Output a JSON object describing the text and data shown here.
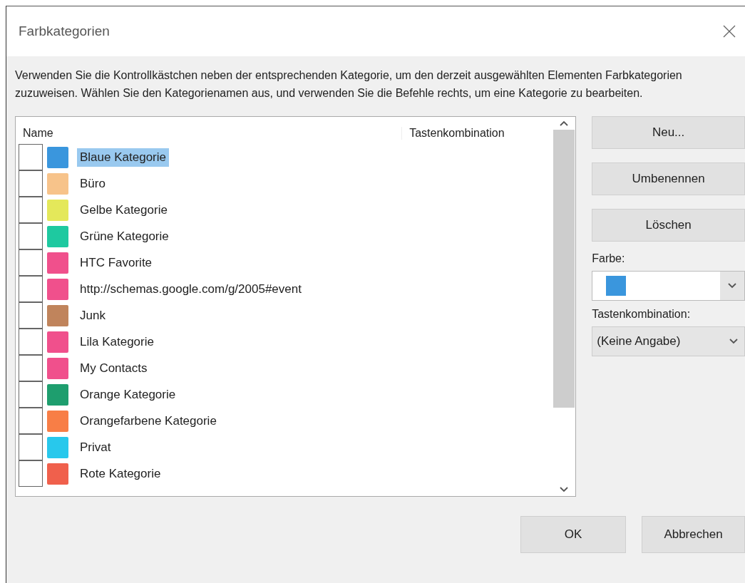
{
  "window": {
    "title": "Farbkategorien"
  },
  "description": "Verwenden Sie die Kontrollkästchen neben der entsprechenden Kategorie, um den derzeit ausgewählten Elementen Farbkategorien zuzuweisen. Wählen Sie den Kategorienamen aus, und verwenden Sie die Befehle rechts, um eine Kategorie zu bearbeiten.",
  "list": {
    "columns": [
      "Name",
      "Tastenkombination"
    ],
    "rows": [
      {
        "name": "Blaue Kategorie",
        "color": "#3a96dd",
        "checked": false,
        "selected": true
      },
      {
        "name": "Büro",
        "color": "#f7c38a",
        "checked": false,
        "selected": false
      },
      {
        "name": "Gelbe Kategorie",
        "color": "#e4e85a",
        "checked": false,
        "selected": false
      },
      {
        "name": "Grüne Kategorie",
        "color": "#1ec9a0",
        "checked": false,
        "selected": false
      },
      {
        "name": "HTC Favorite",
        "color": "#f0508c",
        "checked": false,
        "selected": false
      },
      {
        "name": "http://schemas.google.com/g/2005#event",
        "color": "#f0508c",
        "checked": false,
        "selected": false
      },
      {
        "name": "Junk",
        "color": "#c0845c",
        "checked": false,
        "selected": false
      },
      {
        "name": "Lila Kategorie",
        "color": "#f0508c",
        "checked": false,
        "selected": false
      },
      {
        "name": "My Contacts",
        "color": "#f0508c",
        "checked": false,
        "selected": false
      },
      {
        "name": "Orange Kategorie",
        "color": "#1e9e6e",
        "checked": false,
        "selected": false
      },
      {
        "name": "Orangefarbene Kategorie",
        "color": "#f87e46",
        "checked": false,
        "selected": false
      },
      {
        "name": "Privat",
        "color": "#28c8ec",
        "checked": false,
        "selected": false
      },
      {
        "name": "Rote Kategorie",
        "color": "#f0604c",
        "checked": false,
        "selected": false
      }
    ]
  },
  "side_buttons": [
    "Neu...",
    "Umbenennen",
    "Löschen"
  ],
  "color_field": {
    "label": "Farbe:",
    "color": "#3a96dd"
  },
  "shortcut_field": {
    "label": "Tastenkombination:",
    "value": "(Keine Angabe)"
  },
  "buttons": [
    "OK",
    "Abbrechen"
  ]
}
